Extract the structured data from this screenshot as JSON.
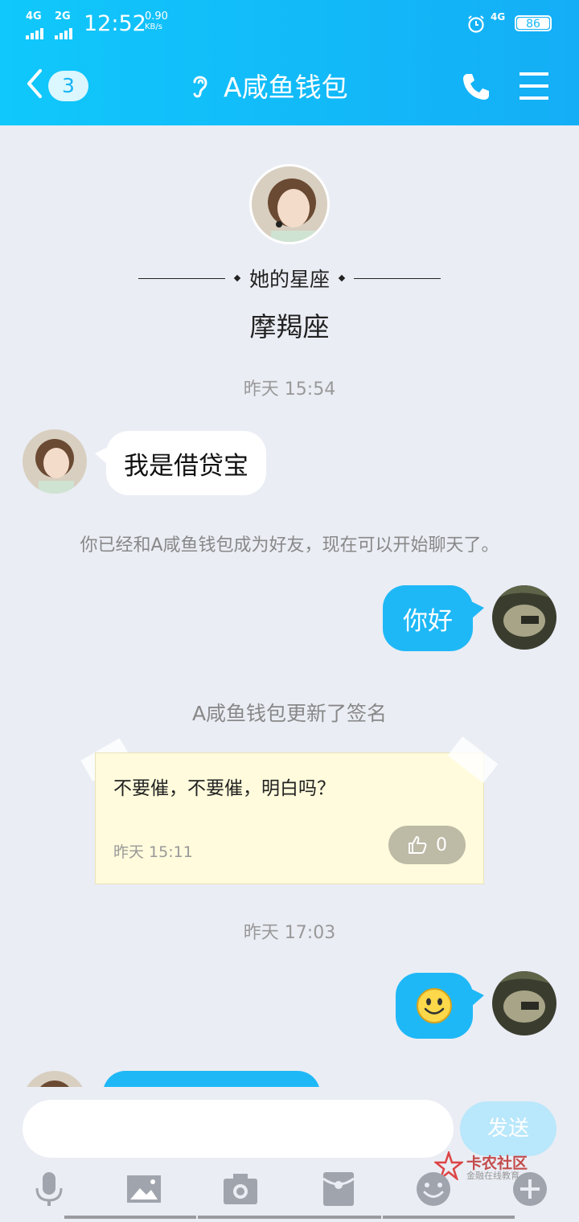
{
  "status_bar": {
    "sig1": "4G",
    "sig2": "2G",
    "time": "12:52",
    "speed_value": "0.90",
    "speed_unit": "KB/s",
    "network": "4G",
    "battery": "86"
  },
  "header": {
    "unread_count": "3",
    "title": "A咸鱼钱包",
    "icons": [
      "back-icon",
      "ear-icon",
      "phone-icon",
      "menu-icon"
    ]
  },
  "profile": {
    "zodiac_label": "她的星座",
    "zodiac_value": "摩羯座"
  },
  "messages": {
    "ts1": "昨天 15:54",
    "msg_in_1": "我是借贷宝",
    "system_friend": "你已经和A咸鱼钱包成为好友，现在可以开始聊天了。",
    "msg_out_1": "你好",
    "system_sign": "A咸鱼钱包更新了签名",
    "ts2": "昨天 17:03",
    "msg_out_2_icon": "smiley-emoji"
  },
  "signature_note": {
    "text": "不要催，不要催，明白吗？",
    "time": "昨天 15:11",
    "likes": "0"
  },
  "input": {
    "placeholder": "",
    "send_label": "发送"
  },
  "watermark": {
    "title": "卡农社区",
    "subtitle": "金融在线教育"
  },
  "colors": {
    "header_start": "#10c8fb",
    "header_end": "#14aef6",
    "bubble_out": "#1fb8f7",
    "background": "#eaedf4"
  }
}
